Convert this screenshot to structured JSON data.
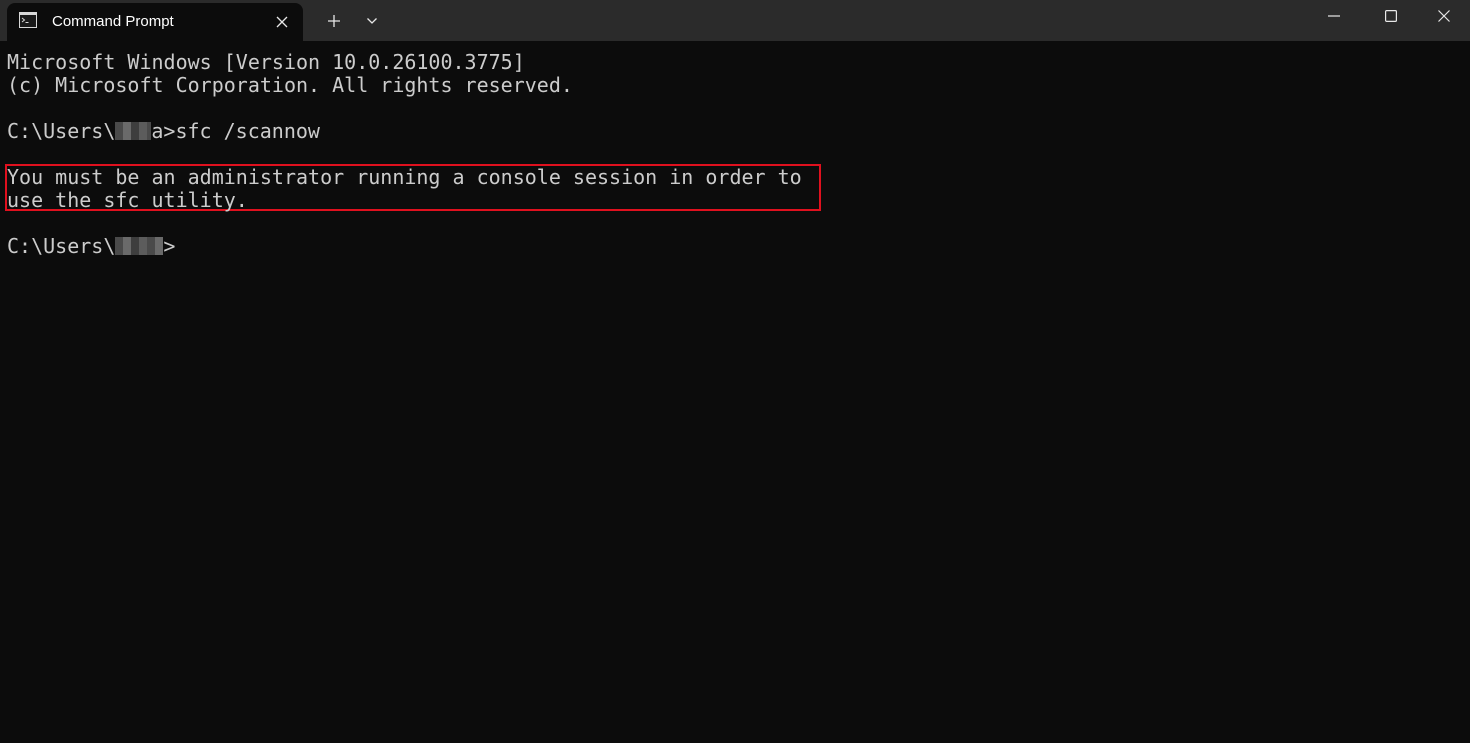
{
  "window": {
    "tab_title": "Command Prompt",
    "tab_icon": "terminal-icon",
    "close_tab_icon": "close-icon",
    "new_tab_icon": "plus-icon",
    "dropdown_icon": "chevron-down-icon",
    "minimize_icon": "minimize-icon",
    "maximize_icon": "maximize-icon",
    "close_window_icon": "close-icon"
  },
  "console": {
    "line1": "Microsoft Windows [Version 10.0.26100.3775]",
    "line2": "(c) Microsoft Corporation. All rights reserved.",
    "prompt1_prefix": "C:\\Users\\",
    "prompt1_suffix": "a>sfc /scannow",
    "error_line1": "You must be an administrator running a console session in order to",
    "error_line2": "use the sfc utility.",
    "prompt2_prefix": "C:\\Users\\",
    "prompt2_suffix": ">"
  },
  "colors": {
    "background": "#0c0c0c",
    "titlebar": "#2b2b2b",
    "text": "#cccccc",
    "highlight_border": "#e0101e"
  }
}
